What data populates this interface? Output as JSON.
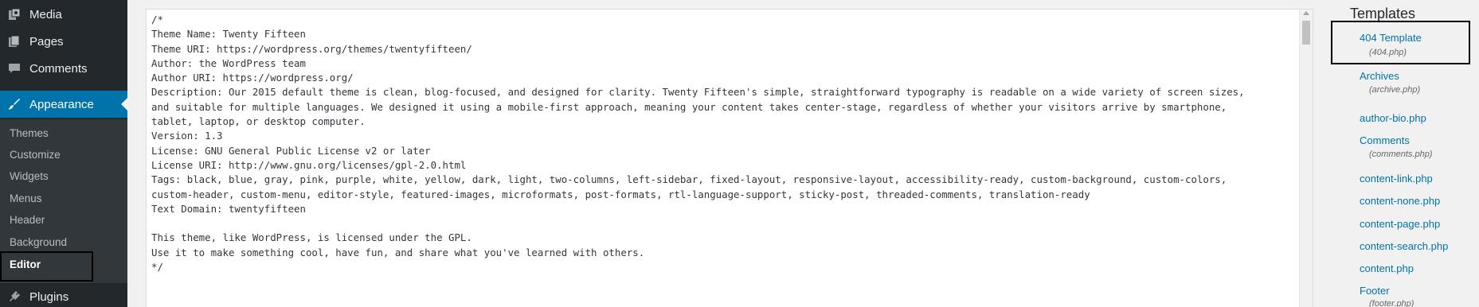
{
  "admin_menu": {
    "media": "Media",
    "pages": "Pages",
    "comments": "Comments",
    "appearance": "Appearance",
    "plugins": "Plugins",
    "submenu": [
      "Themes",
      "Customize",
      "Widgets",
      "Menus",
      "Header",
      "Background",
      "Editor"
    ],
    "current_submenu": "Editor"
  },
  "editor": {
    "lines": [
      "/*",
      "Theme Name: Twenty Fifteen",
      "Theme URI: https://wordpress.org/themes/twentyfifteen/",
      "Author: the WordPress team",
      "Author URI: https://wordpress.org/",
      "Description: Our 2015 default theme is clean, blog-focused, and designed for clarity. Twenty Fifteen's simple, straightforward typography is readable on a wide variety of screen sizes,",
      "and suitable for multiple languages. We designed it using a mobile-first approach, meaning your content takes center-stage, regardless of whether your visitors arrive by smartphone,",
      "tablet, laptop, or desktop computer.",
      "Version: 1.3",
      "License: GNU General Public License v2 or later",
      "License URI: http://www.gnu.org/licenses/gpl-2.0.html",
      "Tags: black, blue, gray, pink, purple, white, yellow, dark, light, two-columns, left-sidebar, fixed-layout, responsive-layout, accessibility-ready, custom-background, custom-colors,",
      "custom-header, custom-menu, editor-style, featured-images, microformats, post-formats, rtl-language-support, sticky-post, threaded-comments, translation-ready",
      "Text Domain: twentyfifteen",
      "",
      "This theme, like WordPress, is licensed under the GPL.",
      "Use it to make something cool, have fun, and share what you've learned with others.",
      "*/",
      "",
      "",
      "/**"
    ]
  },
  "templates": {
    "title": "Templates",
    "items": [
      {
        "name": "404 Template",
        "file": "(404.php)"
      },
      {
        "name": "Archives",
        "file": "(archive.php)"
      },
      {
        "name": "author-bio.php",
        "file": ""
      },
      {
        "name": "Comments",
        "file": "(comments.php)"
      },
      {
        "name": "content-link.php",
        "file": ""
      },
      {
        "name": "content-none.php",
        "file": ""
      },
      {
        "name": "content-page.php",
        "file": ""
      },
      {
        "name": "content-search.php",
        "file": ""
      },
      {
        "name": "content.php",
        "file": ""
      },
      {
        "name": "Footer",
        "file": "(footer.php)"
      }
    ]
  },
  "colors": {
    "sidebar_bg": "#23282d",
    "submenu_bg": "#32373c",
    "accent": "#0073aa",
    "link": "#0073aa"
  }
}
